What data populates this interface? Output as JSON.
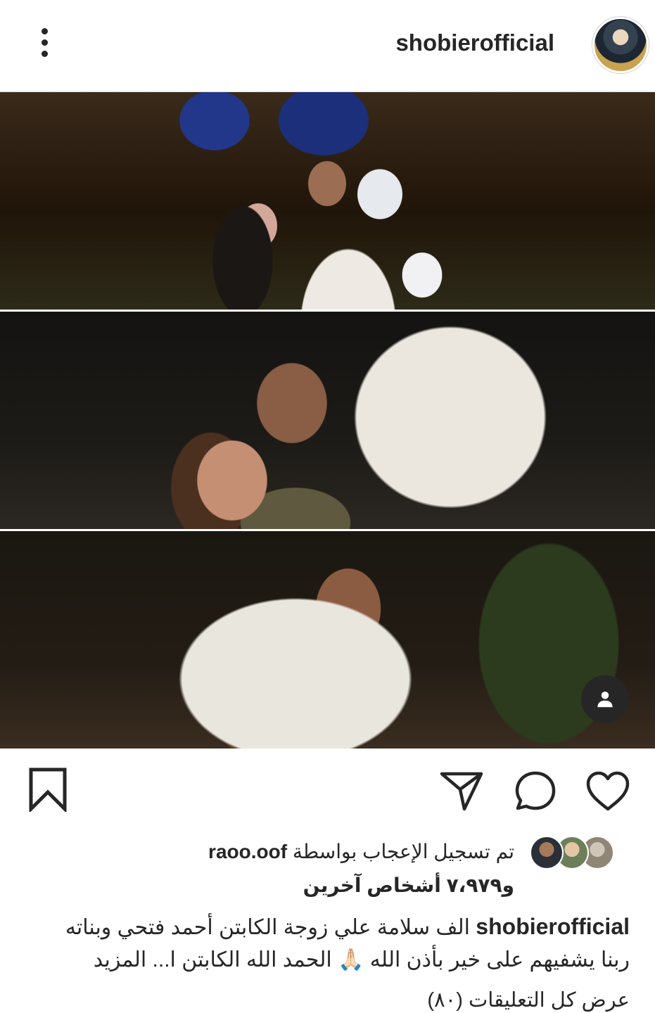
{
  "header": {
    "username": "shobierofficial"
  },
  "post": {
    "liked_by_prefix": "تم تسجيل الإعجاب بواسطة",
    "liked_by_user": "raoo.oof",
    "likes_count": "و٧،٩٧٩ أشخاص آخرين",
    "caption_user": "shobierofficial",
    "caption_line1": "الف سلامة علي زوجة الكابتن أحمد فتحي وبناته",
    "caption_line2": "ربنا يشفيهم على خير بأذن الله",
    "caption_emoji": "🙏🏻",
    "caption_line2b": "الحمد الله الكابتن ا...",
    "more_label": "المزيد",
    "view_comments": "عرض كل التعليقات (٨٠)"
  },
  "icons": {
    "menu": "more-vertical-icon",
    "bookmark": "bookmark-icon",
    "share": "send-icon",
    "comment": "comment-icon",
    "like": "heart-icon",
    "tag": "user-tag-icon"
  },
  "colors": {
    "text": "#262626",
    "divider": "#dbdbdb",
    "background": "#ffffff"
  }
}
